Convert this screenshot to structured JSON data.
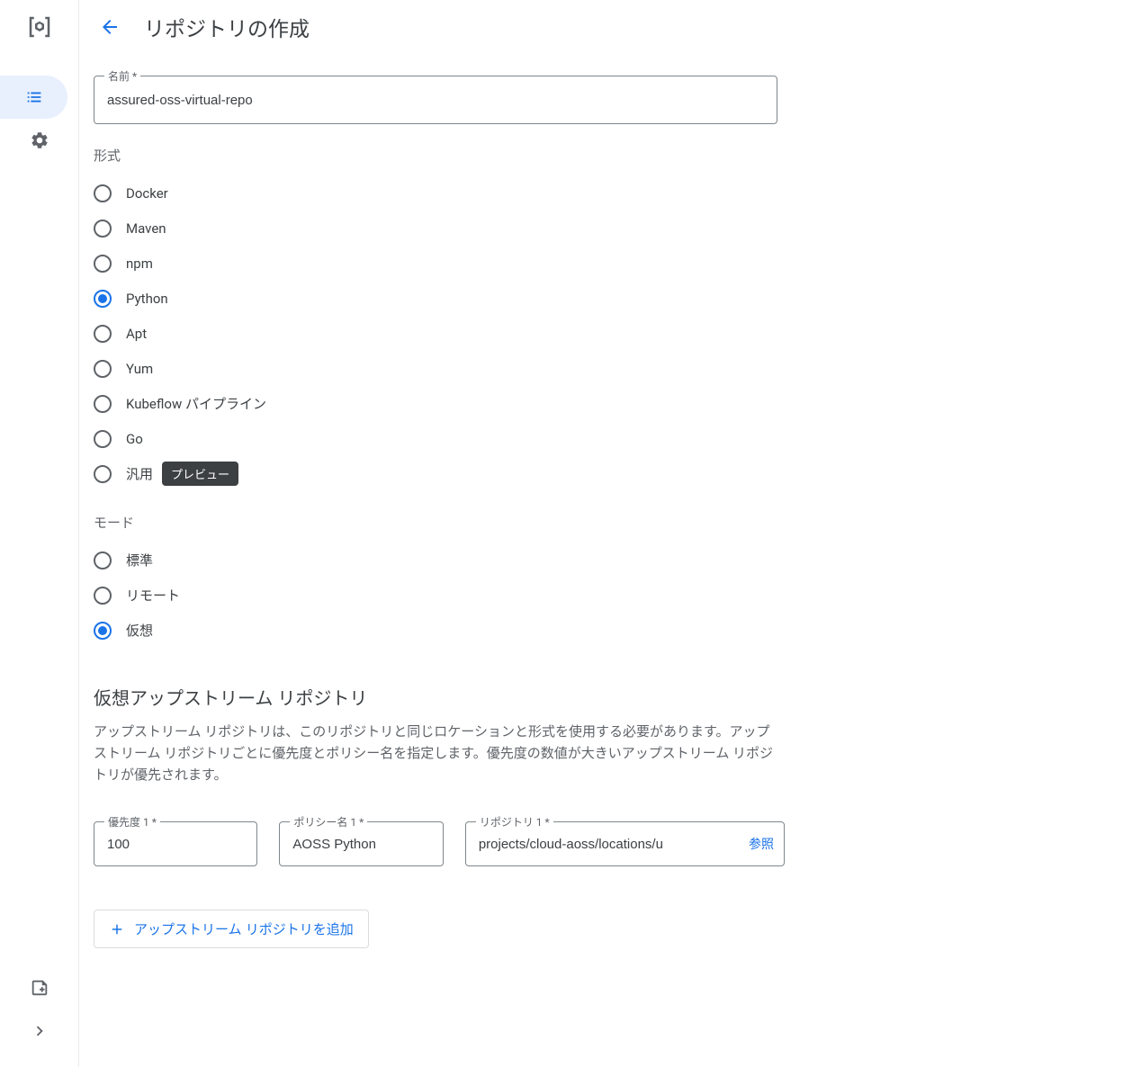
{
  "header": {
    "title": "リポジトリの作成"
  },
  "name_field": {
    "label": "名前 *",
    "value": "assured-oss-virtual-repo"
  },
  "format": {
    "label": "形式",
    "options": [
      {
        "label": "Docker",
        "selected": false
      },
      {
        "label": "Maven",
        "selected": false
      },
      {
        "label": "npm",
        "selected": false
      },
      {
        "label": "Python",
        "selected": true
      },
      {
        "label": "Apt",
        "selected": false
      },
      {
        "label": "Yum",
        "selected": false
      },
      {
        "label": "Kubeflow パイプライン",
        "selected": false
      },
      {
        "label": "Go",
        "selected": false
      },
      {
        "label": "汎用",
        "selected": false,
        "badge": "プレビュー"
      }
    ]
  },
  "mode": {
    "label": "モード",
    "options": [
      {
        "label": "標準",
        "selected": false
      },
      {
        "label": "リモート",
        "selected": false
      },
      {
        "label": "仮想",
        "selected": true
      }
    ]
  },
  "upstream": {
    "heading": "仮想アップストリーム リポジトリ",
    "description": "アップストリーム リポジトリは、このリポジトリと同じロケーションと形式を使用する必要があります。アップストリーム リポジトリごとに優先度とポリシー名を指定します。優先度の数値が大きいアップストリーム リポジトリが優先されます。",
    "row": {
      "priority_label": "優先度 1 *",
      "priority_value": "100",
      "policy_label": "ポリシー名 1 *",
      "policy_value": "AOSS Python",
      "repo_label": "リポジトリ 1 *",
      "repo_value": "projects/cloud-aoss/locations/u",
      "browse": "参照"
    },
    "add_button": "アップストリーム リポジトリを追加"
  }
}
